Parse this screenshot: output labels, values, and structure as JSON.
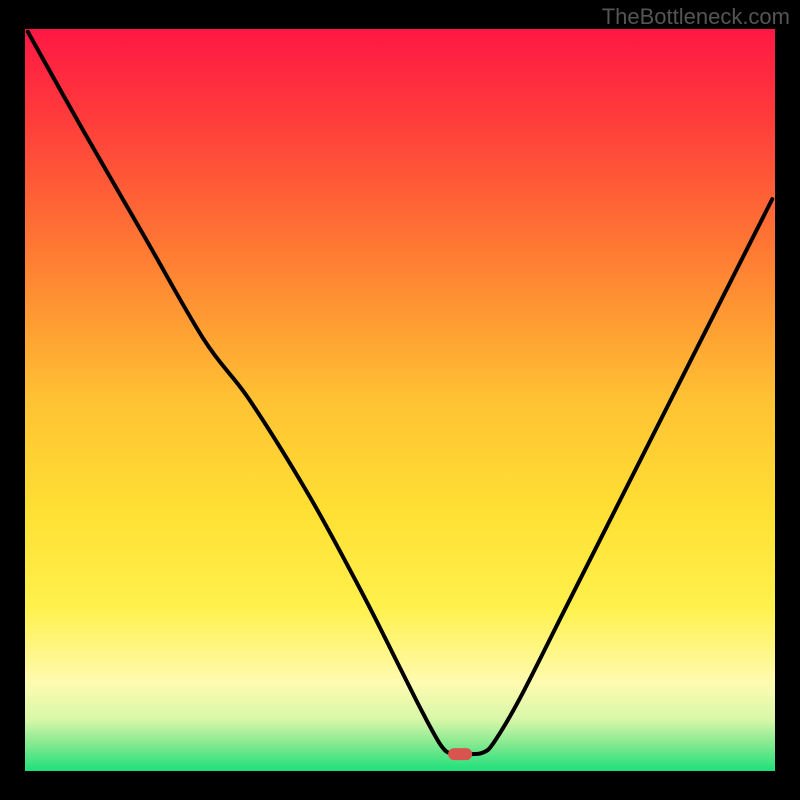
{
  "watermark": "TheBottleneck.com",
  "chart_data": {
    "type": "line",
    "title": "",
    "xlabel": "",
    "ylabel": "",
    "xlim": [
      0,
      100
    ],
    "ylim": [
      0,
      100
    ],
    "background_gradient": {
      "stops": [
        {
          "offset": 0.0,
          "color": "#ff1744"
        },
        {
          "offset": 0.12,
          "color": "#ff3b3b"
        },
        {
          "offset": 0.3,
          "color": "#ff7a33"
        },
        {
          "offset": 0.5,
          "color": "#ffc233"
        },
        {
          "offset": 0.65,
          "color": "#ffe033"
        },
        {
          "offset": 0.78,
          "color": "#fff14d"
        },
        {
          "offset": 0.88,
          "color": "#fffbb0"
        },
        {
          "offset": 0.93,
          "color": "#d7f7a8"
        },
        {
          "offset": 0.965,
          "color": "#7de88e"
        },
        {
          "offset": 1.0,
          "color": "#19e07a"
        }
      ]
    },
    "series": [
      {
        "name": "bottleneck-curve",
        "color": "#000000",
        "x": [
          0.5,
          8,
          16,
          24,
          30,
          38,
          45,
          50,
          53,
          55.5,
          57,
          59,
          61,
          62.5,
          66,
          72,
          80,
          88,
          96,
          99.5
        ],
        "y": [
          99.5,
          86,
          72,
          58,
          50,
          37,
          24,
          14,
          8,
          3.5,
          2.4,
          2.4,
          2.6,
          4,
          10,
          22,
          38,
          54,
          70,
          77
        ]
      }
    ],
    "marker": {
      "name": "min-point",
      "x": 58,
      "y": 2.4,
      "color": "#d9534f",
      "shape": "pill"
    }
  }
}
